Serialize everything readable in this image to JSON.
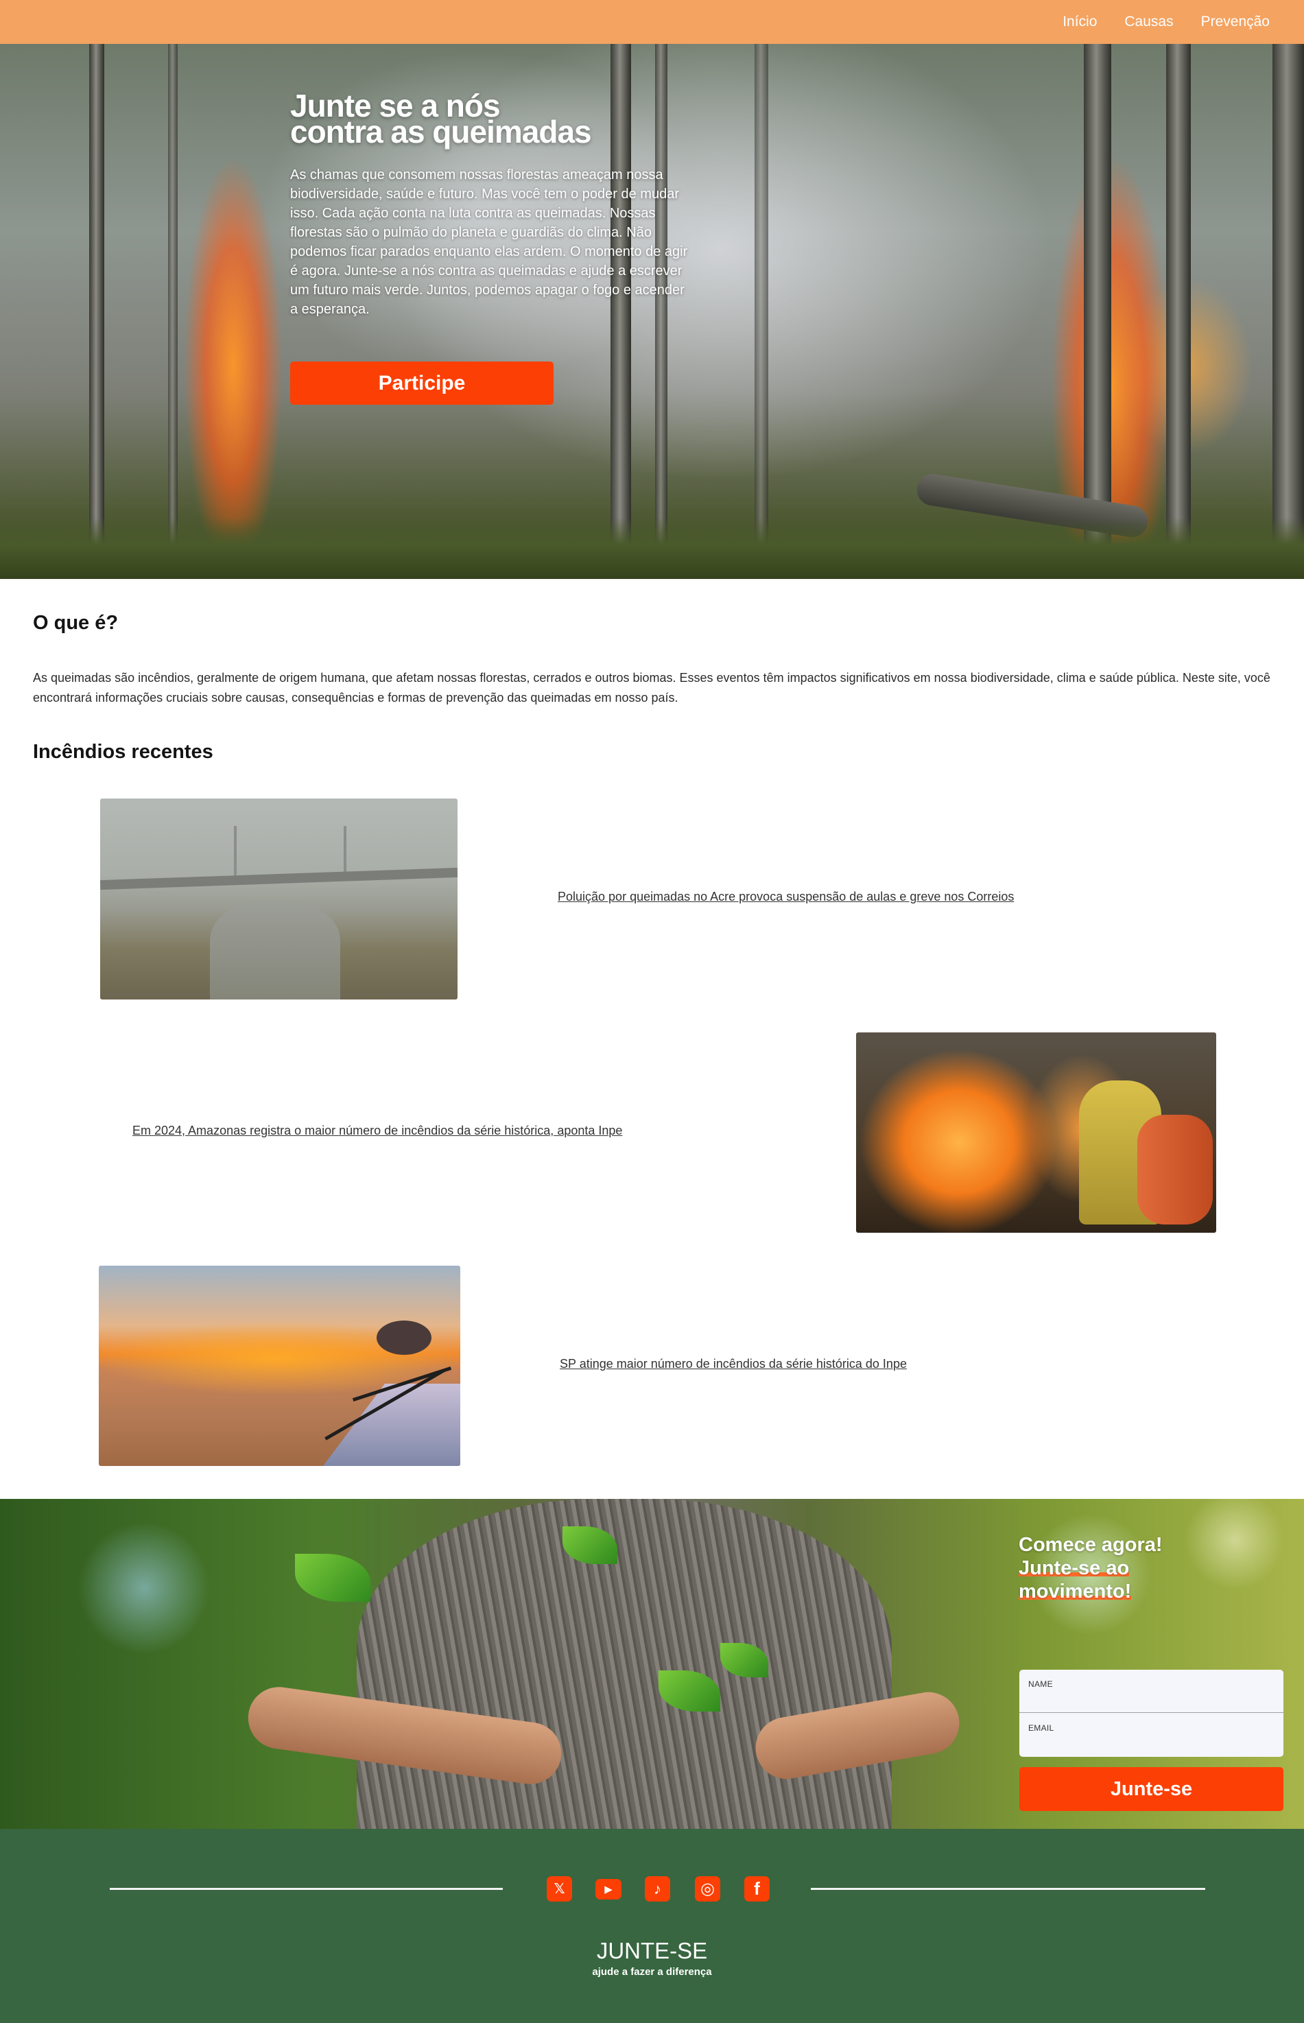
{
  "nav": {
    "items": [
      {
        "label": "Início"
      },
      {
        "label": "Causas"
      },
      {
        "label": "Prevenção"
      }
    ]
  },
  "hero": {
    "title_line1": "Junte se a nós",
    "title_line2": "contra as queimadas",
    "text": "As chamas que consomem nossas florestas ameaçam nossa biodiversidade, saúde e futuro. Mas você tem o poder de mudar isso. Cada ação conta na luta contra as queimadas. Nossas florestas são o pulmão do planeta e guardiãs do clima. Não podemos ficar parados enquanto elas ardem. O momento de agir é agora. Junte-se a nós contra as queimadas e ajude a escrever um futuro mais verde. Juntos, podemos apagar o fogo e acender a esperança.",
    "button": "Participe"
  },
  "about": {
    "title": "O que é?",
    "text": "As queimadas são incêndios, geralmente de origem humana, que afetam nossas florestas, cerrados e outros biomas. Esses eventos têm impactos significativos em nossa biodiversidade, clima e saúde pública. Neste site, você encontrará informações cruciais sobre causas, consequências e formas de prevenção das queimadas em nosso país."
  },
  "recent": {
    "title": "Incêndios recentes",
    "items": [
      {
        "text": "Poluição por queimadas no Acre provoca suspensão de aulas e greve nos Correios"
      },
      {
        "text": "Em 2024, Amazonas registra o maior número de incêndios da série histórica, aponta Inpe"
      },
      {
        "text": "SP atinge maior número de incêndios da série histórica do Inpe"
      }
    ]
  },
  "cta": {
    "line1": "Comece agora!",
    "line2": "Junte-se ao",
    "line3": "movimento!",
    "name_label": "NAME",
    "email_label": "EMAIL",
    "name_value": "",
    "email_value": "",
    "button": "Junte-se"
  },
  "footer": {
    "social": [
      {
        "icon": "x-icon",
        "glyph": "𝕏"
      },
      {
        "icon": "youtube-icon",
        "glyph": "▶"
      },
      {
        "icon": "tiktok-icon",
        "glyph": "♪"
      },
      {
        "icon": "instagram-icon",
        "glyph": "◎"
      },
      {
        "icon": "facebook-icon",
        "glyph": "f"
      }
    ],
    "brand": "JUNTE-SE",
    "tagline": "ajude a fazer a diferença"
  },
  "colors": {
    "nav_bg": "#f4a361",
    "accent": "#fc3f04",
    "footer_bg": "#376640"
  }
}
